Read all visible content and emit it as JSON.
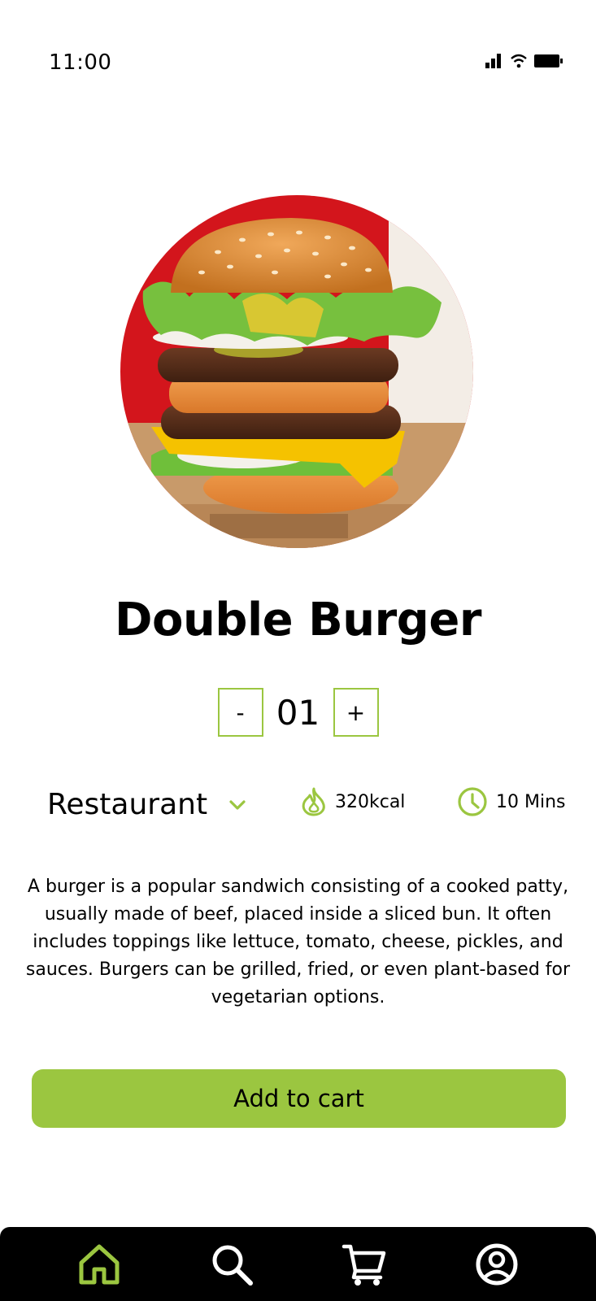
{
  "status_bar": {
    "time": "11:00"
  },
  "product": {
    "image_alt": "Double burger photo",
    "title": "Double Burger",
    "quantity": "01",
    "decrement_label": "-",
    "increment_label": "+"
  },
  "info": {
    "restaurant": "Restaurant",
    "calories": "320kcal",
    "time": "10 Mins"
  },
  "description": "A burger is a popular sandwich consisting of a cooked patty, usually made of beef, placed inside a sliced bun. It often includes toppings like lettuce, tomato, cheese, pickles, and sauces. Burgers can be grilled, fried, or even plant-based for vegetarian options.",
  "cta": {
    "label": "Add to cart"
  },
  "nav": {
    "items": [
      {
        "icon": "home-icon",
        "active": true
      },
      {
        "icon": "search-icon",
        "active": false
      },
      {
        "icon": "cart-icon",
        "active": false
      },
      {
        "icon": "profile-icon",
        "active": false
      }
    ]
  },
  "colors": {
    "accent": "#9bc640",
    "nav_bg": "#000000",
    "text": "#000000",
    "background": "#ffffff"
  }
}
